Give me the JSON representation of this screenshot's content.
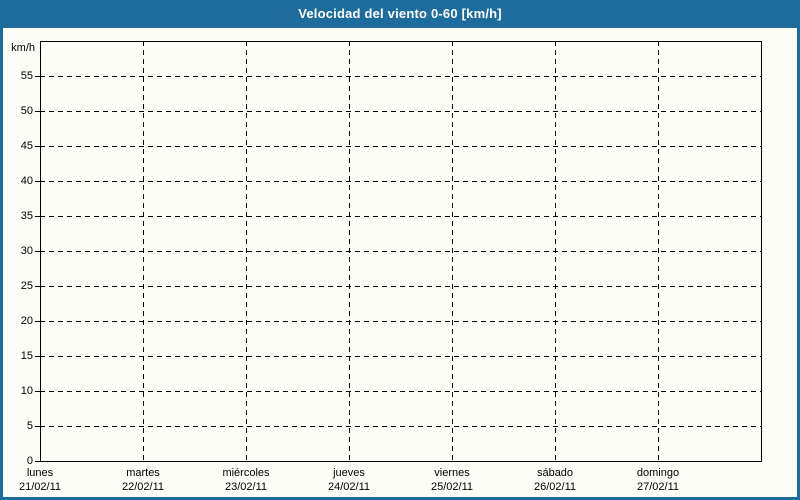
{
  "titlebar": {
    "title": "Velocidad del viento 0-60 [km/h]"
  },
  "colors": {
    "titlebar_bg": "#1e6c9e",
    "title_text": "#ffffff",
    "page_border": "#1e6c9e",
    "page_bg": "#fdfdf8",
    "grid": "#000000",
    "label_text": "#000000"
  },
  "chart_data": {
    "type": "line",
    "title": "Velocidad del viento 0-60 [km/h]",
    "ylabel": "km/h",
    "ylim": [
      0,
      60
    ],
    "y_ticks": [
      0,
      5,
      10,
      15,
      20,
      25,
      30,
      35,
      40,
      45,
      50,
      55
    ],
    "x_ticks": [
      {
        "day": "lunes",
        "date": "21/02/11"
      },
      {
        "day": "martes",
        "date": "22/02/11"
      },
      {
        "day": "miércoles",
        "date": "23/02/11"
      },
      {
        "day": "jueves",
        "date": "24/02/11"
      },
      {
        "day": "viernes",
        "date": "25/02/11"
      },
      {
        "day": "sábado",
        "date": "26/02/11"
      },
      {
        "day": "domingo",
        "date": "27/02/11"
      }
    ],
    "series": [],
    "grid": "dashed",
    "legend": "none"
  }
}
